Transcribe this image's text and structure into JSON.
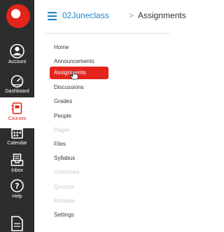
{
  "app": {
    "logo_icon": "canvas-logo-icon",
    "accent": "#e3251c",
    "link_color": "#2487c7",
    "nav_bg": "#2d2d2d"
  },
  "global_nav": {
    "items": [
      {
        "label": "Account",
        "icon": "account-icon"
      },
      {
        "label": "Dashboard",
        "icon": "dashboard-icon"
      },
      {
        "label": "Courses",
        "icon": "courses-icon",
        "active": true
      },
      {
        "label": "Calendar",
        "icon": "calendar-icon"
      },
      {
        "label": "Inbox",
        "icon": "inbox-icon"
      },
      {
        "label": "Help",
        "icon": "help-icon"
      }
    ],
    "bottom_icon": "page-icon"
  },
  "header": {
    "menu_icon": "hamburger-icon",
    "course": "02Juneclass",
    "separator": ">",
    "current_page": "Assignments"
  },
  "course_nav": {
    "items": [
      {
        "label": "Home",
        "state": "enabled"
      },
      {
        "label": "Announcements",
        "state": "enabled"
      },
      {
        "label": "Assignments",
        "state": "active"
      },
      {
        "label": "Discussions",
        "state": "enabled"
      },
      {
        "label": "Grades",
        "state": "enabled"
      },
      {
        "label": "People",
        "state": "enabled"
      },
      {
        "label": "Pages",
        "state": "disabled"
      },
      {
        "label": "Files",
        "state": "enabled"
      },
      {
        "label": "Syllabus",
        "state": "enabled"
      },
      {
        "label": "Outcomes",
        "state": "disabled"
      },
      {
        "label": "Quizzes",
        "state": "disabled"
      },
      {
        "label": "Modules",
        "state": "disabled"
      },
      {
        "label": "Settings",
        "state": "enabled"
      }
    ]
  },
  "cursor_icon": "hand-pointer-icon"
}
